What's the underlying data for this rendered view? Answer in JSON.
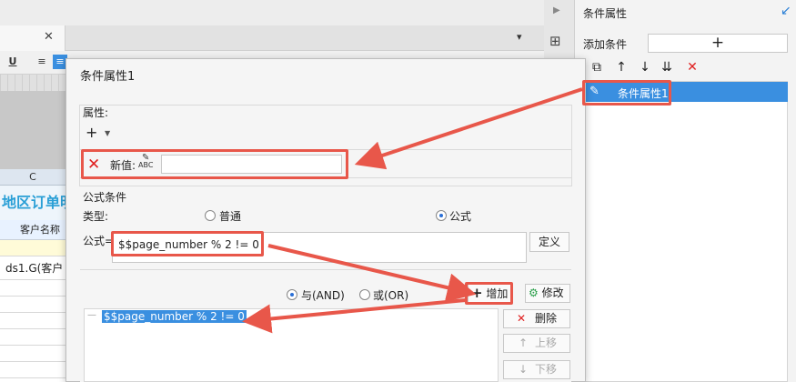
{
  "background": {
    "title_cell": "地区订单明",
    "column_letter": "C",
    "header_cell": "客户名称",
    "data_cell": "ds1.G(客户",
    "toolbar_underline": "U"
  },
  "right_panel": {
    "title": "条件属性",
    "add_condition_label": "添加条件",
    "add_button_symbol": "+",
    "list_item": "条件属性1"
  },
  "dialog": {
    "title": "条件属性1",
    "property_section": {
      "label": "属性:",
      "add_symbol": "+",
      "new_value_label": "新值:",
      "abc_label": "ABC",
      "new_value": ""
    },
    "formula_condition": {
      "section_label": "公式条件",
      "type_label": "类型:",
      "type_options": [
        "普通",
        "公式"
      ],
      "selected_type": "公式",
      "formula_label": "公式=",
      "formula_value": "$$page_number % 2 != 0",
      "define_button": "定义"
    },
    "logic": {
      "options": [
        "与(AND)",
        "或(OR)"
      ],
      "selected": "与(AND)",
      "add_button": "增加",
      "edit_button": "修改"
    },
    "condition_list": [
      "$$page_number % 2 != 0"
    ],
    "side_buttons": {
      "delete": "删除",
      "move_up": "上移",
      "move_down": "下移"
    }
  },
  "colors": {
    "highlight": "#e8574a",
    "selection": "#3a8fe0",
    "delete_red": "#e02020"
  }
}
